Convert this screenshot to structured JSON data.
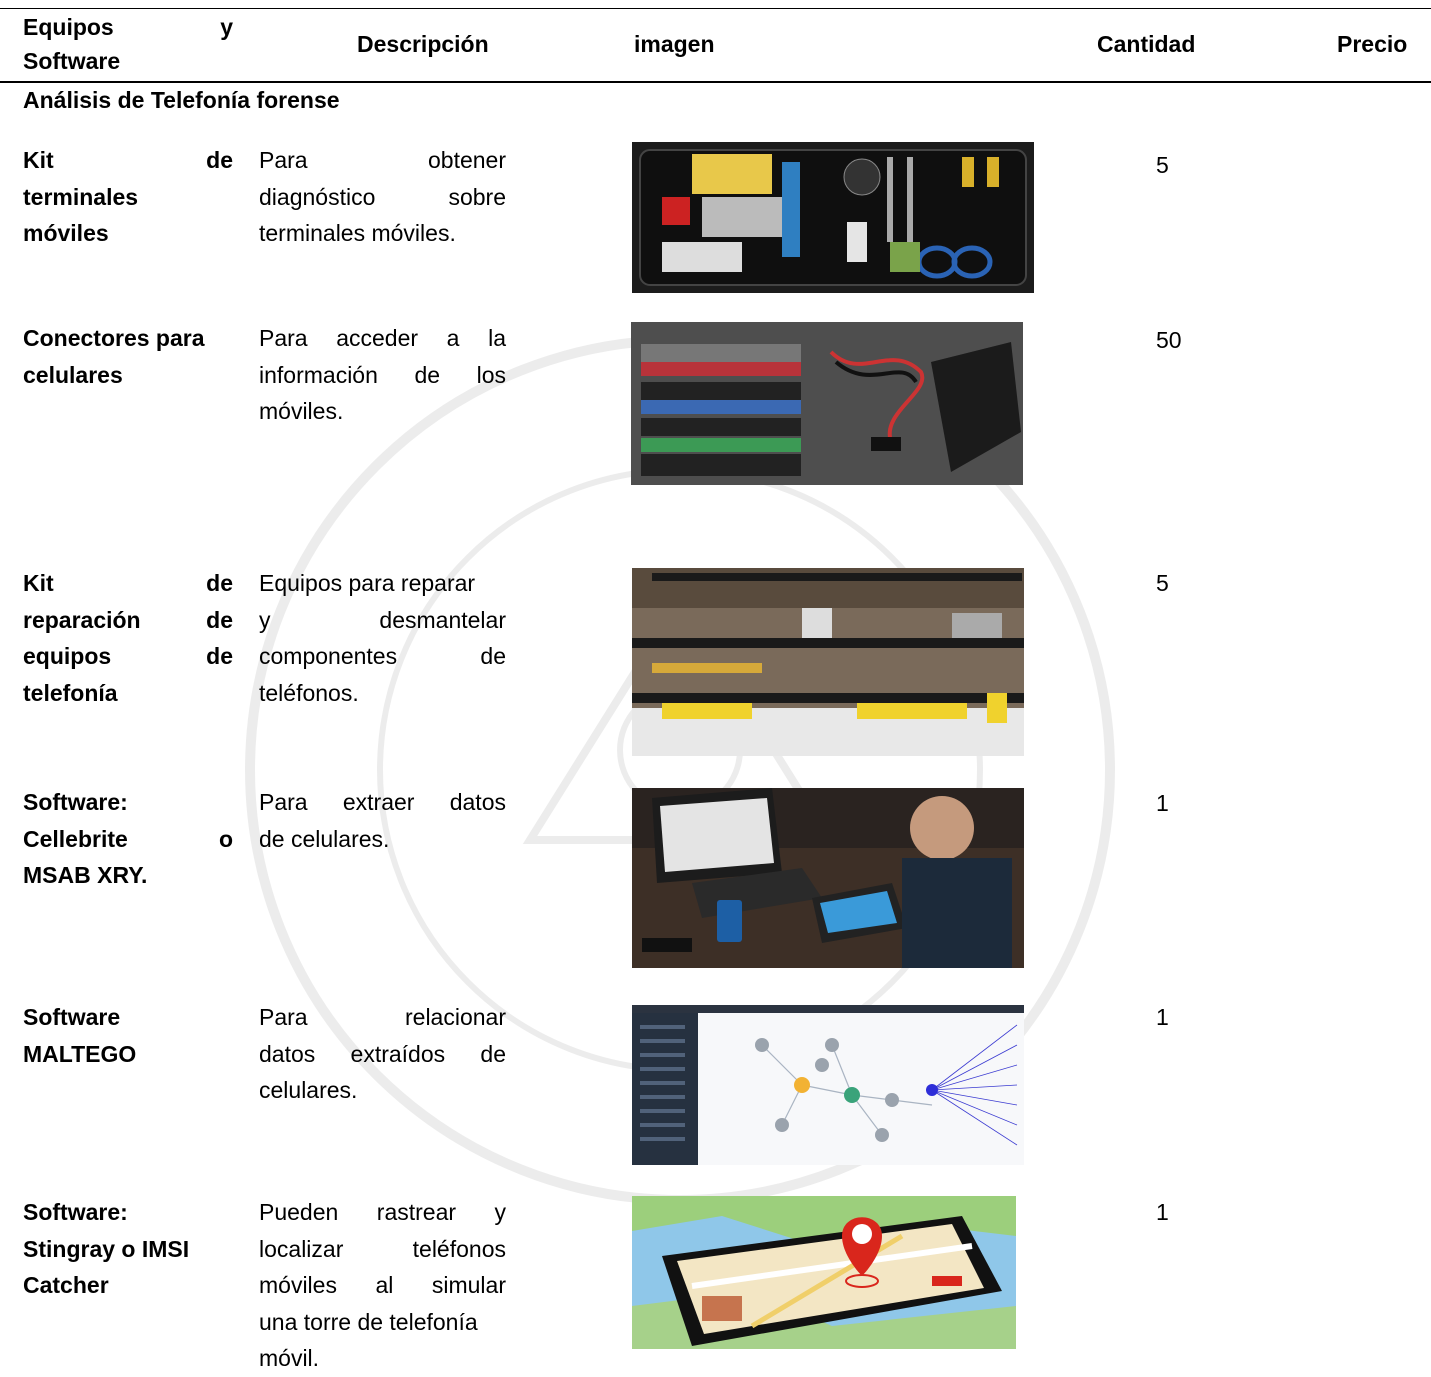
{
  "headers": {
    "col1_line1_a": "Equipos",
    "col1_line1_b": "y",
    "col1_line2": "Software",
    "descripcion": "Descripción",
    "imagen": "imagen",
    "cantidad": "Cantidad",
    "precio": "Precio"
  },
  "section_title": "Análisis de Telefonía forense",
  "rows": [
    {
      "name_lines": [
        [
          "Kit",
          "de"
        ],
        [
          "terminales"
        ],
        [
          "móviles"
        ]
      ],
      "desc_lines": [
        [
          "Para",
          "obtener"
        ],
        [
          "diagnóstico",
          "sobre"
        ],
        [
          "terminales móviles."
        ]
      ],
      "image": "Kit de herramientas en estuche negro",
      "qty": "5"
    },
    {
      "name_lines": [
        [
          "Conectores para"
        ],
        [
          "celulares"
        ]
      ],
      "desc_lines": [
        [
          "Para",
          "acceder",
          "a",
          "la"
        ],
        [
          "información",
          "de",
          "los"
        ],
        [
          "móviles."
        ]
      ],
      "image": "Conectores y cables con disco externo",
      "qty": "50"
    },
    {
      "name_lines": [
        [
          "Kit",
          "de"
        ],
        [
          "reparación",
          "de"
        ],
        [
          "equipos",
          "de"
        ],
        [
          "telefonía"
        ]
      ],
      "desc_lines": [
        [
          "Equipos para reparar"
        ],
        [
          "y",
          "desmantelar"
        ],
        [
          "componentes",
          "de"
        ],
        [
          "teléfonos."
        ]
      ],
      "image": "Estación de reparación con microscopio",
      "qty": "5"
    },
    {
      "name_lines": [
        [
          "Software:"
        ],
        [
          "Cellebrite",
          "o"
        ],
        [
          "MSAB XRY."
        ]
      ],
      "desc_lines": [
        [
          "Para",
          "extraer",
          "datos"
        ],
        [
          "de celulares."
        ]
      ],
      "image": "Persona extrayendo datos de un celular",
      "qty": "1"
    },
    {
      "name_lines": [
        [
          "Software"
        ],
        [
          "MALTEGO"
        ]
      ],
      "desc_lines": [
        [
          "Para",
          "relacionar"
        ],
        [
          "datos",
          "extraídos",
          "de"
        ],
        [
          "celulares."
        ]
      ],
      "image": "Captura de pantalla de Maltego",
      "qty": "1"
    },
    {
      "name_lines": [
        [
          "Software:"
        ],
        [
          "Stingray o IMSI"
        ],
        [
          "Catcher"
        ]
      ],
      "desc_lines": [
        [
          "Pueden",
          "rastrear",
          "y"
        ],
        [
          "localizar",
          "teléfonos"
        ],
        [
          "móviles",
          "al",
          "simular"
        ],
        [
          "una torre de telefonía"
        ],
        [
          "móvil."
        ]
      ],
      "image": "Teléfono con mapa y marcador",
      "qty": "1"
    }
  ]
}
